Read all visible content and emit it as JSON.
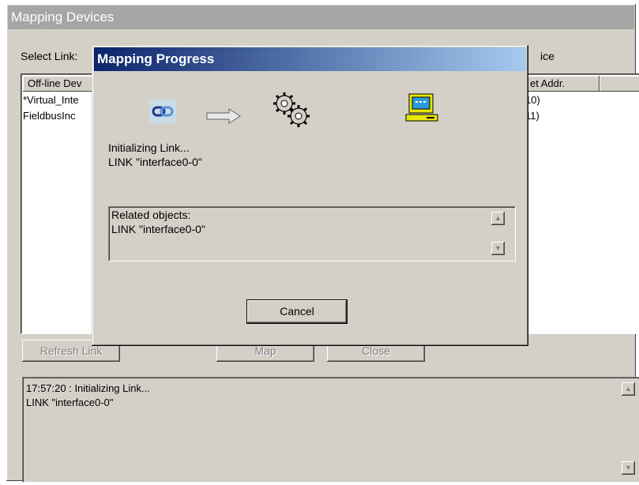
{
  "window": {
    "title": "Mapping Devices"
  },
  "select_link_label": "Select Link:",
  "right_label_fragment": "ice",
  "list": {
    "columns": [
      "Off-line Dev",
      "et Addr."
    ],
    "rows": [
      {
        "name": "*Virtual_Inte",
        "addr": "10)"
      },
      {
        "name": "FieldbusInc",
        "addr": "11)"
      }
    ]
  },
  "buttons": {
    "refresh": "Refresh Link",
    "map": "Map",
    "close": "Close"
  },
  "log": {
    "lines": [
      "17:57:20 : Initializing Link...",
      "LINK \"interface0-0\""
    ]
  },
  "dialog": {
    "title": "Mapping Progress",
    "status": [
      "Initializing Link...",
      "LINK \"interface0-0\""
    ],
    "related_label": "Related objects:",
    "related_items": [
      "LINK \"interface0-0\""
    ],
    "cancel": "Cancel",
    "icons": [
      "link-icon",
      "arrow-right-icon",
      "gears-icon",
      "computer-icon"
    ]
  }
}
